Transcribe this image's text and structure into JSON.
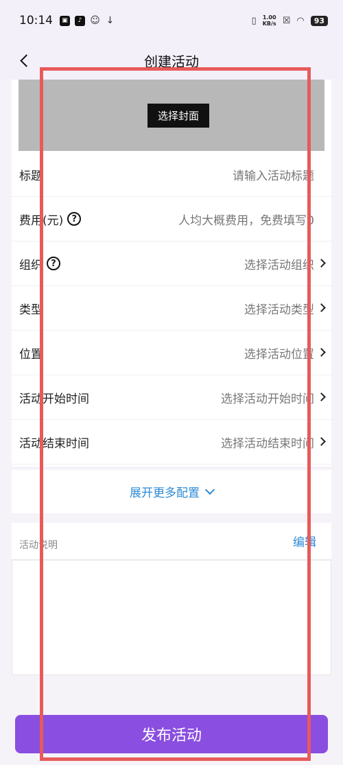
{
  "status_bar": {
    "time": "10:14",
    "net_speed_value": "1.00",
    "net_speed_unit": "KB/s",
    "battery": "93",
    "app_icons": [
      "bilibili-icon",
      "tiktok-icon",
      "robot-icon",
      "download-icon"
    ]
  },
  "nav": {
    "title": "创建活动"
  },
  "cover": {
    "button_label": "选择封面"
  },
  "form_rows": [
    {
      "label": "标题",
      "value": "请输入活动标题",
      "help": false,
      "chevron": false
    },
    {
      "label": "费用(元)",
      "value": "人均大概费用，免费填写0",
      "help": true,
      "chevron": false
    },
    {
      "label": "组织",
      "value": "选择活动组织",
      "help": true,
      "chevron": true
    },
    {
      "label": "类型",
      "value": "选择活动类型",
      "help": false,
      "chevron": true
    },
    {
      "label": "位置",
      "value": "选择活动位置",
      "help": false,
      "chevron": true
    },
    {
      "label": "活动开始时间",
      "value": "选择活动开始时间",
      "help": false,
      "chevron": true
    },
    {
      "label": "活动结束时间",
      "value": "选择活动结束时间",
      "help": false,
      "chevron": true
    }
  ],
  "expand": {
    "label": "展开更多配置"
  },
  "description": {
    "label": "活动说明",
    "edit_label": "编辑"
  },
  "publish": {
    "label": "发布活动"
  },
  "colors": {
    "accent": "#8a4ee0",
    "link": "#2e8bd6",
    "highlight": "#e85a5a"
  }
}
